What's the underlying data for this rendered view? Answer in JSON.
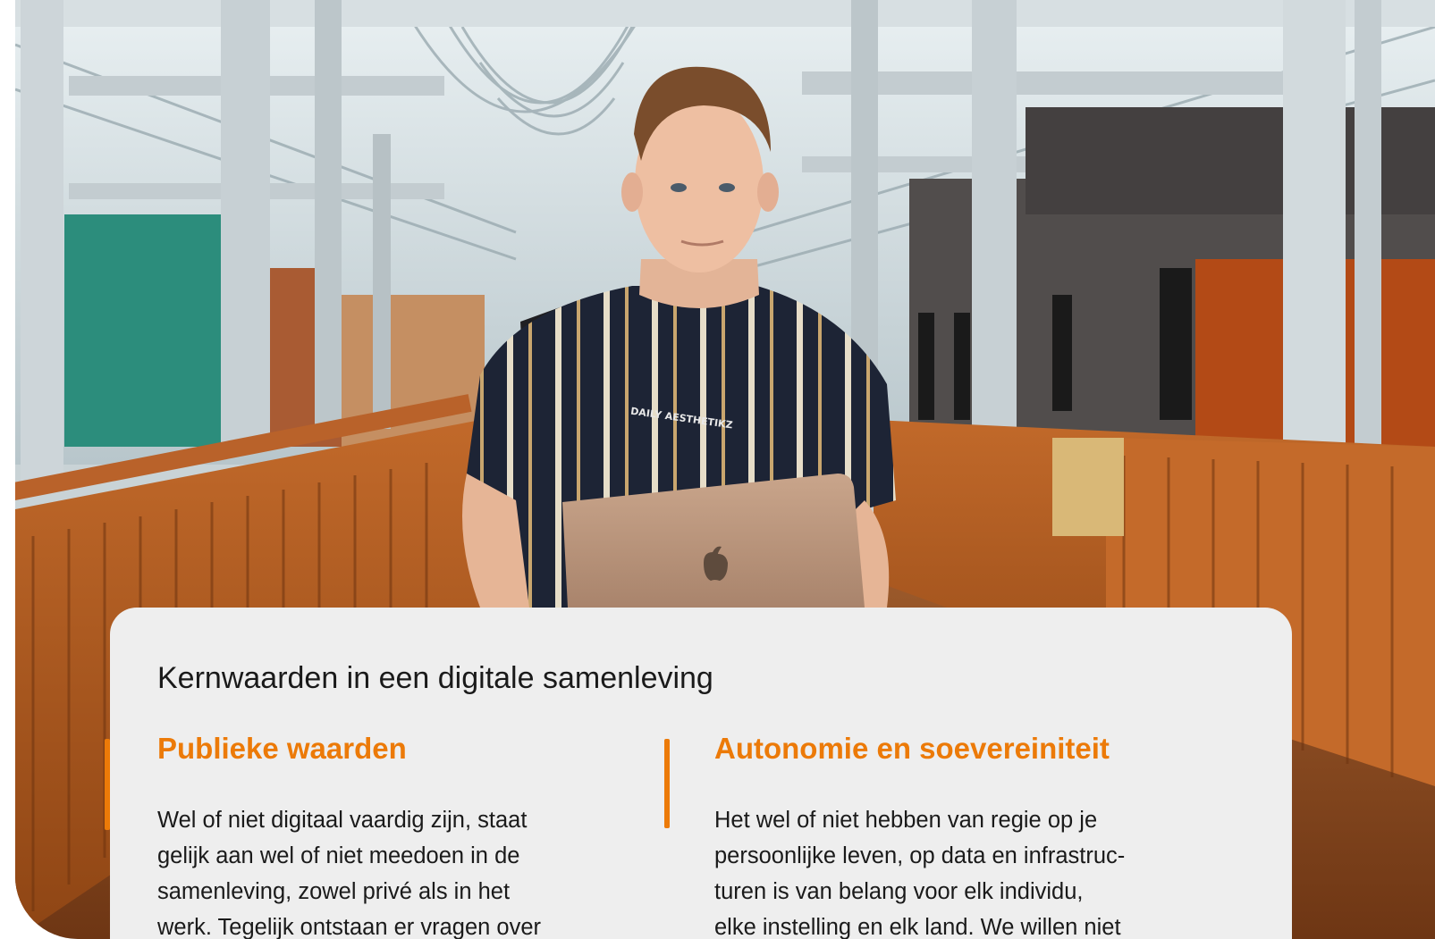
{
  "card": {
    "title": "Kernwaarden in een digitale samenleving",
    "columns": [
      {
        "heading": "Publieke waarden",
        "lines": [
          "Wel of niet digitaal vaardig zijn, staat",
          "gelijk aan wel of niet meedoen in de",
          "samenleving, zowel privé als in het",
          "werk. Tegelijk ontstaan er vragen over"
        ]
      },
      {
        "heading": "Autonomie en soevereiniteit",
        "lines": [
          "Het wel of niet hebben van regie op je",
          "persoonlijke leven, op data en infrastruc-",
          "turen is van belang voor elk individu,",
          "elke instelling en elk land. We willen niet"
        ]
      }
    ]
  },
  "photo": {
    "shirt_print": "DAILY AESTHETIKZ"
  },
  "colors": {
    "accent": "#ec7a08",
    "card_background": "#eeeeee",
    "text": "#1a1a1a"
  }
}
